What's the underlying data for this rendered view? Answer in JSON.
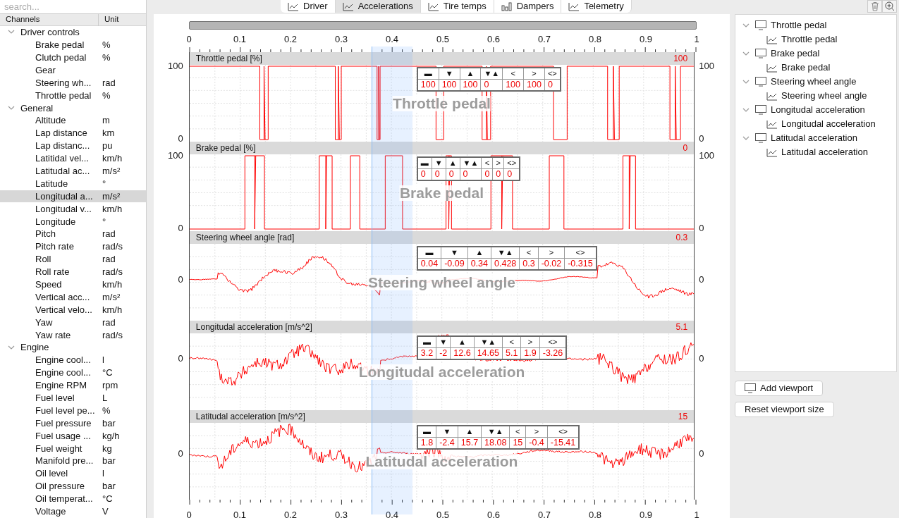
{
  "search": {
    "placeholder": "search..."
  },
  "channel_columns": [
    "Channels",
    "Unit"
  ],
  "channel_groups": [
    {
      "label": "Driver controls",
      "expanded": true,
      "children": [
        {
          "name": "Brake pedal",
          "unit": "%",
          "selected": false
        },
        {
          "name": "Clutch pedal",
          "unit": "%",
          "selected": false
        },
        {
          "name": "Gear",
          "selected": false
        },
        {
          "name": "Steering wh...",
          "unit": "rad",
          "selected": false
        },
        {
          "name": "Throttle pedal",
          "unit": "%",
          "selected": false
        }
      ]
    },
    {
      "label": "General",
      "expanded": true,
      "children": [
        {
          "name": "Altitude",
          "unit": "m",
          "selected": false
        },
        {
          "name": "Lap distance",
          "unit": "km",
          "selected": false
        },
        {
          "name": "Lap distanc...",
          "unit": "pu",
          "selected": false
        },
        {
          "name": "Latitidal vel...",
          "unit": "km/h",
          "selected": false
        },
        {
          "name": "Latitudal ac...",
          "unit": "m/s²",
          "selected": false
        },
        {
          "name": "Latitude",
          "unit": "°",
          "selected": false
        },
        {
          "name": "Longitudal a...",
          "unit": "m/s²",
          "selected": true
        },
        {
          "name": "Longitudal v...",
          "unit": "km/h",
          "selected": false
        },
        {
          "name": "Longitude",
          "unit": "°",
          "selected": false
        },
        {
          "name": "Pitch",
          "unit": "rad",
          "selected": false
        },
        {
          "name": "Pitch rate",
          "unit": "rad/s",
          "selected": false
        },
        {
          "name": "Roll",
          "unit": "rad",
          "selected": false
        },
        {
          "name": "Roll rate",
          "unit": "rad/s",
          "selected": false
        },
        {
          "name": "Speed",
          "unit": "km/h",
          "selected": false
        },
        {
          "name": "Vertical acc...",
          "unit": "m/s²",
          "selected": false
        },
        {
          "name": "Vertical velo...",
          "unit": "km/h",
          "selected": false
        },
        {
          "name": "Yaw",
          "unit": "rad",
          "selected": false
        },
        {
          "name": "Yaw rate",
          "unit": "rad/s",
          "selected": false
        }
      ]
    },
    {
      "label": "Engine",
      "expanded": true,
      "children": [
        {
          "name": "Engine cool...",
          "unit": "l",
          "selected": false
        },
        {
          "name": "Engine cool...",
          "unit": "°C",
          "selected": false
        },
        {
          "name": "Engine RPM",
          "unit": "rpm",
          "selected": false
        },
        {
          "name": "Fuel level",
          "unit": "L",
          "selected": false
        },
        {
          "name": "Fuel level pe...",
          "unit": "%",
          "selected": false
        },
        {
          "name": "Fuel pressure",
          "unit": "bar",
          "selected": false
        },
        {
          "name": "Fuel usage ...",
          "unit": "kg/h",
          "selected": false
        },
        {
          "name": "Fuel weight",
          "unit": "kg",
          "selected": false
        },
        {
          "name": "Manifold pre...",
          "unit": "bar",
          "selected": false
        },
        {
          "name": "Oil level",
          "unit": "l",
          "selected": false
        },
        {
          "name": "Oil pressure",
          "unit": "bar",
          "selected": false
        },
        {
          "name": "Oil temperat...",
          "unit": "°C",
          "selected": false
        },
        {
          "name": "Voltage",
          "unit": "V",
          "selected": false
        }
      ]
    }
  ],
  "tabs": [
    {
      "label": "Driver",
      "selected": false
    },
    {
      "label": "Accelerations",
      "selected": true
    },
    {
      "label": "Tire temps",
      "selected": false
    },
    {
      "label": "Dampers",
      "selected": false
    },
    {
      "label": "Telemetry",
      "selected": false
    }
  ],
  "top_axis": {
    "ticks": [
      "0",
      "0.1",
      "0.2",
      "0.3",
      "0.4",
      "0.5",
      "0.6",
      "0.7",
      "0.8",
      "0.9",
      "1"
    ]
  },
  "strips": [
    {
      "title": "Throttle pedal [%]",
      "value": "100",
      "kind": "throttle",
      "background_label": "Throttle pedal",
      "left_ticks": [
        {
          "label": "100",
          "kind": "top"
        },
        {
          "label": "0",
          "kind": "bottom"
        }
      ],
      "right_ticks": [
        {
          "label": "100",
          "kind": "top"
        },
        {
          "label": "0",
          "kind": "bottom"
        }
      ],
      "stats": {
        "headers": [
          "▬",
          "▼",
          "▲",
          "▼▲",
          "<",
          ">",
          "<>"
        ],
        "values": [
          "100",
          "100",
          "100",
          "0",
          "100",
          "100",
          "0"
        ]
      }
    },
    {
      "title": "Brake pedal [%]",
      "value": "0",
      "kind": "brake",
      "background_label": "Brake pedal",
      "left_ticks": [
        {
          "label": "100",
          "kind": "top"
        },
        {
          "label": "0",
          "kind": "bottom"
        }
      ],
      "right_ticks": [
        {
          "label": "100",
          "kind": "top"
        },
        {
          "label": "0",
          "kind": "bottom"
        }
      ],
      "stats": {
        "headers": [
          "▬",
          "▼",
          "▲",
          "▼▲",
          "<",
          ">",
          "<>"
        ],
        "values": [
          "0",
          "0",
          "0",
          "0",
          "0",
          "0",
          "0"
        ]
      }
    },
    {
      "title": "Steering wheel angle [rad]",
      "value": "0.3",
      "kind": "wave",
      "background_label": "Steering wheel angle",
      "left_ticks": [
        {
          "label": "0",
          "kind": "center"
        }
      ],
      "right_ticks": [
        {
          "label": "0",
          "kind": "center"
        }
      ],
      "stats": {
        "headers": [
          "▬",
          "▼",
          "▲",
          "▼▲",
          "<",
          ">",
          "<>"
        ],
        "values": [
          "0.04",
          "-0.09",
          "0.34",
          "0.428",
          "0.3",
          "-0.02",
          "-0.315"
        ]
      }
    },
    {
      "title": "Longitudal acceleration [m/s^2]",
      "value": "5.1",
      "kind": "wave",
      "background_label": "Longitudal acceleration",
      "left_ticks": [
        {
          "label": "0",
          "kind": "upper"
        }
      ],
      "right_ticks": [
        {
          "label": "0",
          "kind": "upper"
        }
      ],
      "stats": {
        "headers": [
          "▬",
          "▼",
          "▲",
          "▼▲",
          "<",
          ">",
          "<>"
        ],
        "values": [
          "3.2",
          "-2",
          "12.6",
          "14.65",
          "5.1",
          "1.9",
          "-3.26"
        ]
      }
    },
    {
      "title": "Latitudal acceleration [m/s^2]",
      "value": "15",
      "kind": "wave",
      "background_label": "Latitudal acceleration",
      "left_ticks": [
        {
          "label": "0",
          "kind": "middle"
        }
      ],
      "right_ticks": [
        {
          "label": "0",
          "kind": "middle"
        }
      ],
      "stats": {
        "headers": [
          "▬",
          "▼",
          "▲",
          "▼▲",
          "<",
          ">",
          "<>"
        ],
        "values": [
          "1.8",
          "-2.4",
          "15.7",
          "18.08",
          "15",
          "-0.4",
          "-15.41"
        ]
      }
    }
  ],
  "bottom_axis": {
    "ticks": [
      "0",
      "0.1",
      "0.2",
      "0.3",
      "0.4",
      "0.5",
      "0.6",
      "0.7",
      "0.8",
      "0.9",
      "1"
    ]
  },
  "viewports": [
    {
      "label": "Throttle pedal",
      "expanded": true,
      "children": [
        {
          "label": "Throttle pedal"
        }
      ]
    },
    {
      "label": "Brake pedal",
      "expanded": true,
      "children": [
        {
          "label": "Brake pedal"
        }
      ]
    },
    {
      "label": "Steering wheel angle",
      "expanded": true,
      "children": [
        {
          "label": "Steering wheel angle"
        }
      ]
    },
    {
      "label": "Longitudal acceleration",
      "expanded": true,
      "children": [
        {
          "label": "Longitudal acceleration"
        }
      ]
    },
    {
      "label": "Latitudal acceleration",
      "expanded": true,
      "children": [
        {
          "label": "Latitudal acceleration"
        }
      ]
    }
  ],
  "buttons": [
    {
      "label": "Add viewport"
    },
    {
      "label": "Reset viewport size"
    }
  ]
}
